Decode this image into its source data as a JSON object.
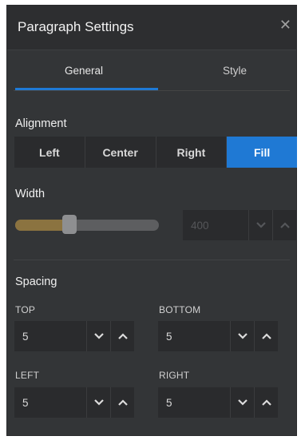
{
  "panel": {
    "title": "Paragraph Settings",
    "close_icon": "close-icon"
  },
  "tabs": [
    {
      "label": "General",
      "active": true
    },
    {
      "label": "Style",
      "active": false
    }
  ],
  "alignment": {
    "label": "Alignment",
    "options": [
      "Left",
      "Center",
      "Right",
      "Fill"
    ],
    "selected": "Fill"
  },
  "width": {
    "label": "Width",
    "slider_level": 0.38,
    "value": "400",
    "disabled": true
  },
  "spacing": {
    "label": "Spacing",
    "top": {
      "label": "TOP",
      "value": "5"
    },
    "bottom": {
      "label": "BOTTOM",
      "value": "5"
    },
    "left": {
      "label": "LEFT",
      "value": "5"
    },
    "right": {
      "label": "RIGHT",
      "value": "5"
    }
  },
  "colors": {
    "accent": "#1f79d4",
    "slider_fill": "#8b7340"
  }
}
